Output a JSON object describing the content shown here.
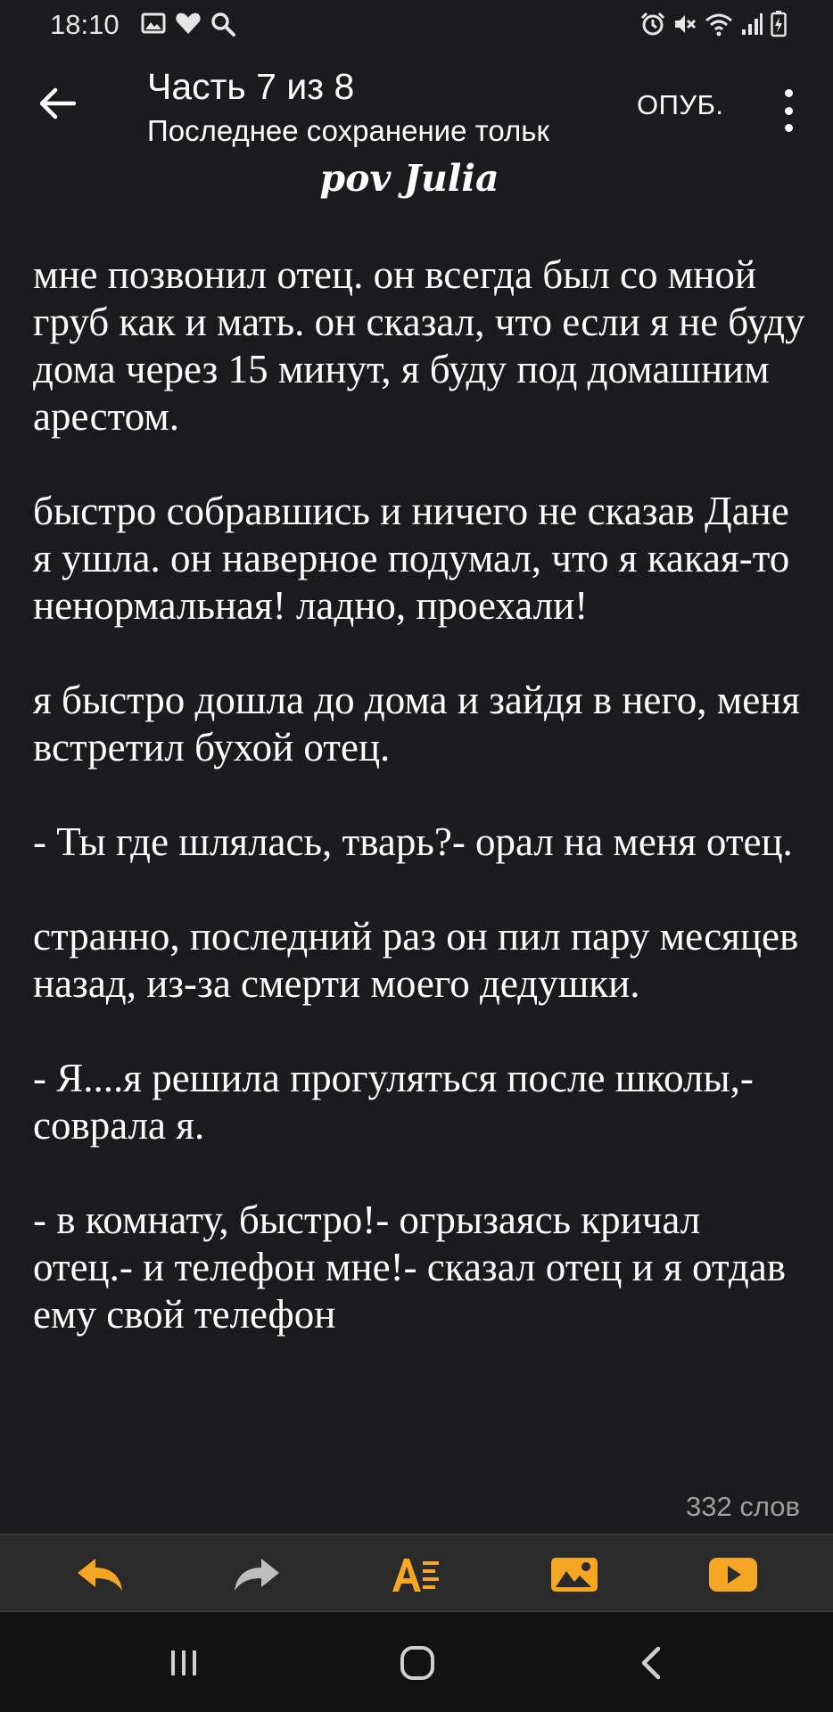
{
  "status_bar": {
    "time": "18:10",
    "left_icons": [
      "gallery-icon",
      "heart-icon",
      "search-icon"
    ],
    "right_icons": [
      "alarm-icon",
      "mute-icon",
      "wifi-icon",
      "signal-icon",
      "battery-icon"
    ]
  },
  "app_bar": {
    "part_title": "Часть 7 из 8",
    "save_status": "Последнее сохранение тольк",
    "publish_label": "ОПУБ."
  },
  "story": {
    "heading": "pov Julia",
    "paragraphs": [
      "мне позвонил отец. он всегда был со мной груб как и мать. он сказал, что если я не буду дома через 15 минут, я буду под домашним арестом.",
      "быстро собравшись и ничего не сказав Дане я ушла. он наверное подумал, что я какая-то ненормальная! ладно, проехали!",
      "я быстро дошла до дома и зайдя в него, меня встретил бухой отец.",
      "- Ты где шлялась, тварь?- орал на меня отец.",
      "странно, последний раз он пил пару месяцев назад, из-за смерти моего дедушки.",
      "- Я....я решила прогуляться после школы,-соврала я.",
      "- в комнату, быстро!- огрызаясь кричал отец.- и телефон мне!- сказал отец и я отдав ему свой телефон"
    ],
    "word_count": "332 слов"
  },
  "toolbar": {
    "accent_color": "#f5a623",
    "buttons": [
      "undo-icon",
      "redo-icon",
      "text-format-icon",
      "insert-image-icon",
      "insert-video-icon"
    ]
  },
  "nav_bar": {
    "buttons": [
      "recent-apps-icon",
      "home-icon",
      "back-icon"
    ]
  }
}
